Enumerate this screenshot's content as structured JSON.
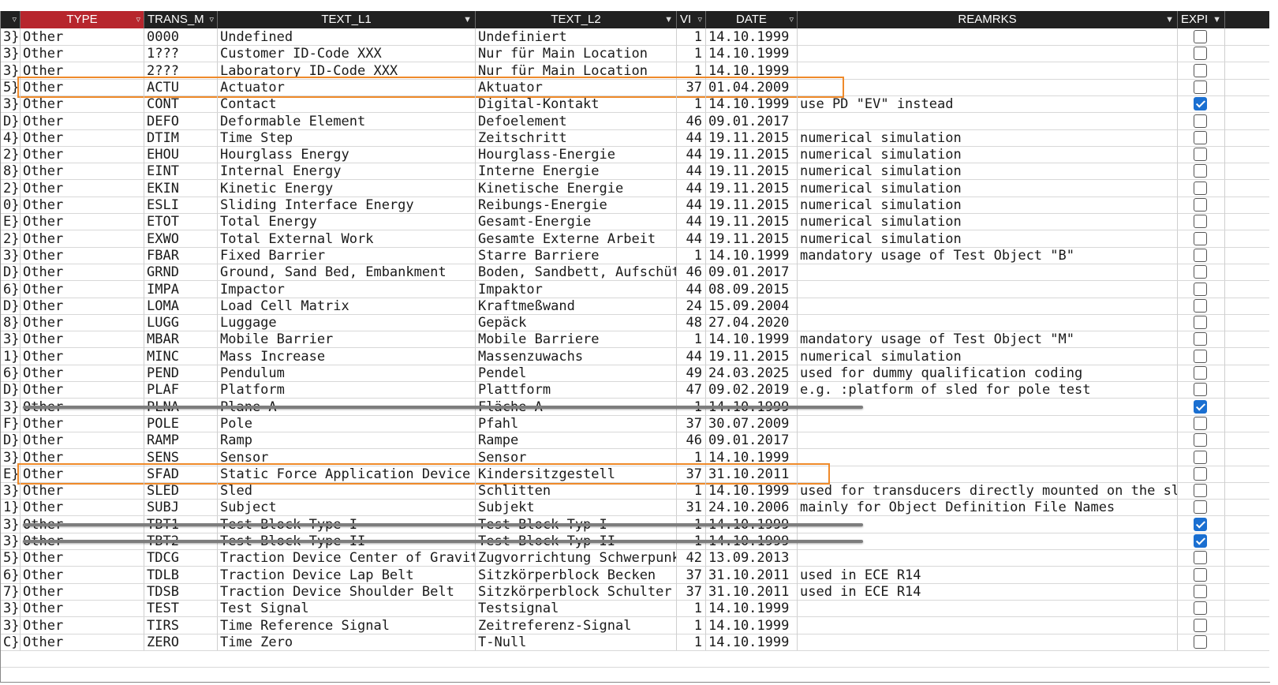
{
  "header": {
    "col_index": "",
    "col_type": "TYPE",
    "col_trans": "TRANS_M",
    "col_text1": "TEXT_L1",
    "col_text2": "TEXT_L2",
    "col_ver": "VI",
    "col_date": "DATE",
    "col_remarks": "REAMRKS",
    "col_expired": "EXPI",
    "filter_icon": "filter-icon",
    "sort_icon": "dropdown-arrow-icon"
  },
  "colors": {
    "header_bg": "#212121",
    "active_header": "#b7262d",
    "highlight_box": "#ef8a2a",
    "checked": "#1a6fd1"
  },
  "rows": [
    {
      "idx": "3}",
      "type": "Other",
      "code": "0000",
      "text1": "Undefined",
      "text2": "Undefiniert",
      "ver": "1",
      "date": "14.10.1999",
      "remarks": "",
      "expired": false,
      "struck": false
    },
    {
      "idx": "3}",
      "type": "Other",
      "code": "1???",
      "text1": "Customer ID-Code XXX",
      "text2": "Nur für Main Location",
      "ver": "1",
      "date": "14.10.1999",
      "remarks": "",
      "expired": false,
      "struck": false
    },
    {
      "idx": "3}",
      "type": "Other",
      "code": "2???",
      "text1": "Laboratory ID-Code XXX",
      "text2": "Nur für Main Location",
      "ver": "1",
      "date": "14.10.1999",
      "remarks": "",
      "expired": false,
      "struck": false
    },
    {
      "idx": "5}",
      "type": "Other",
      "code": "ACTU",
      "text1": "Actuator",
      "text2": "Aktuator",
      "ver": "37",
      "date": "01.04.2009",
      "remarks": "",
      "expired": false,
      "struck": false
    },
    {
      "idx": "3}",
      "type": "Other",
      "code": "CONT",
      "text1": "Contact",
      "text2": "Digital-Kontakt",
      "ver": "1",
      "date": "14.10.1999",
      "remarks": "use PD \"EV\" instead",
      "expired": true,
      "struck": false
    },
    {
      "idx": "D}",
      "type": "Other",
      "code": "DEFO",
      "text1": "Deformable Element",
      "text2": "Defoelement",
      "ver": "46",
      "date": "09.01.2017",
      "remarks": "",
      "expired": false,
      "struck": false
    },
    {
      "idx": "4}",
      "type": "Other",
      "code": "DTIM",
      "text1": "Time Step",
      "text2": "Zeitschritt",
      "ver": "44",
      "date": "19.11.2015",
      "remarks": "numerical simulation",
      "expired": false,
      "struck": false
    },
    {
      "idx": "2}",
      "type": "Other",
      "code": "EHOU",
      "text1": "Hourglass Energy",
      "text2": "Hourglass-Energie",
      "ver": "44",
      "date": "19.11.2015",
      "remarks": "numerical simulation",
      "expired": false,
      "struck": false
    },
    {
      "idx": "8}",
      "type": "Other",
      "code": "EINT",
      "text1": "Internal Energy",
      "text2": "Interne Energie",
      "ver": "44",
      "date": "19.11.2015",
      "remarks": "numerical simulation",
      "expired": false,
      "struck": false
    },
    {
      "idx": "2}",
      "type": "Other",
      "code": "EKIN",
      "text1": "Kinetic Energy",
      "text2": "Kinetische Energie",
      "ver": "44",
      "date": "19.11.2015",
      "remarks": "numerical simulation",
      "expired": false,
      "struck": false
    },
    {
      "idx": "0}",
      "type": "Other",
      "code": "ESLI",
      "text1": "Sliding Interface Energy",
      "text2": "Reibungs-Energie",
      "ver": "44",
      "date": "19.11.2015",
      "remarks": "numerical simulation",
      "expired": false,
      "struck": false
    },
    {
      "idx": "E}",
      "type": "Other",
      "code": "ETOT",
      "text1": "Total Energy",
      "text2": "Gesamt-Energie",
      "ver": "44",
      "date": "19.11.2015",
      "remarks": "numerical simulation",
      "expired": false,
      "struck": false
    },
    {
      "idx": "2}",
      "type": "Other",
      "code": "EXWO",
      "text1": "Total External Work",
      "text2": "Gesamte Externe Arbeit",
      "ver": "44",
      "date": "19.11.2015",
      "remarks": "numerical simulation",
      "expired": false,
      "struck": false
    },
    {
      "idx": "3}",
      "type": "Other",
      "code": "FBAR",
      "text1": "Fixed Barrier",
      "text2": "Starre Barriere",
      "ver": "1",
      "date": "14.10.1999",
      "remarks": "mandatory usage of Test Object \"B\"",
      "expired": false,
      "struck": false
    },
    {
      "idx": "D}",
      "type": "Other",
      "code": "GRND",
      "text1": "Ground, Sand Bed, Embankment",
      "text2": "Boden, Sandbett, Aufschütt",
      "ver": "46",
      "date": "09.01.2017",
      "remarks": "",
      "expired": false,
      "struck": false
    },
    {
      "idx": "6}",
      "type": "Other",
      "code": "IMPA",
      "text1": "Impactor",
      "text2": "Impaktor",
      "ver": "44",
      "date": "08.09.2015",
      "remarks": "",
      "expired": false,
      "struck": false
    },
    {
      "idx": "D}",
      "type": "Other",
      "code": "LOMA",
      "text1": "Load Cell Matrix",
      "text2": "Kraftmeßwand",
      "ver": "24",
      "date": "15.09.2004",
      "remarks": "",
      "expired": false,
      "struck": false
    },
    {
      "idx": "8}",
      "type": "Other",
      "code": "LUGG",
      "text1": "Luggage",
      "text2": "Gepäck",
      "ver": "48",
      "date": "27.04.2020",
      "remarks": "",
      "expired": false,
      "struck": false
    },
    {
      "idx": "3}",
      "type": "Other",
      "code": "MBAR",
      "text1": "Mobile Barrier",
      "text2": "Mobile Barriere",
      "ver": "1",
      "date": "14.10.1999",
      "remarks": "mandatory usage of Test Object \"M\"",
      "expired": false,
      "struck": false
    },
    {
      "idx": "1}",
      "type": "Other",
      "code": "MINC",
      "text1": "Mass Increase",
      "text2": "Massenzuwachs",
      "ver": "44",
      "date": "19.11.2015",
      "remarks": "numerical simulation",
      "expired": false,
      "struck": false
    },
    {
      "idx": "6}",
      "type": "Other",
      "code": "PEND",
      "text1": "Pendulum",
      "text2": "Pendel",
      "ver": "49",
      "date": "24.03.2025",
      "remarks": "used for dummy qualification coding",
      "expired": false,
      "struck": false
    },
    {
      "idx": "D}",
      "type": "Other",
      "code": "PLAF",
      "text1": "Platform",
      "text2": "Plattform",
      "ver": "47",
      "date": "09.02.2019",
      "remarks": "e.g. :platform of sled for pole test",
      "expired": false,
      "struck": false
    },
    {
      "idx": "3}",
      "type": "Other",
      "code": "PLNA",
      "text1": "Plane A",
      "text2": "Fläche A",
      "ver": "1",
      "date": "14.10.1999",
      "remarks": "",
      "expired": true,
      "struck": true
    },
    {
      "idx": "F}",
      "type": "Other",
      "code": "POLE",
      "text1": "Pole",
      "text2": "Pfahl",
      "ver": "37",
      "date": "30.07.2009",
      "remarks": "",
      "expired": false,
      "struck": false
    },
    {
      "idx": "D}",
      "type": "Other",
      "code": "RAMP",
      "text1": "Ramp",
      "text2": "Rampe",
      "ver": "46",
      "date": "09.01.2017",
      "remarks": "",
      "expired": false,
      "struck": false
    },
    {
      "idx": "3}",
      "type": "Other",
      "code": "SENS",
      "text1": "Sensor",
      "text2": "Sensor",
      "ver": "1",
      "date": "14.10.1999",
      "remarks": "",
      "expired": false,
      "struck": false
    },
    {
      "idx": "E}",
      "type": "Other",
      "code": "SFAD",
      "text1": "Static Force Application Device",
      "text2": "Kindersitzgestell",
      "ver": "37",
      "date": "31.10.2011",
      "remarks": "",
      "expired": false,
      "struck": false
    },
    {
      "idx": "3}",
      "type": "Other",
      "code": "SLED",
      "text1": "Sled",
      "text2": "Schlitten",
      "ver": "1",
      "date": "14.10.1999",
      "remarks": "used for transducers directly mounted on the sled",
      "expired": false,
      "struck": false
    },
    {
      "idx": "1}",
      "type": "Other",
      "code": "SUBJ",
      "text1": "Subject",
      "text2": "Subjekt",
      "ver": "31",
      "date": "24.10.2006",
      "remarks": "mainly for Object Definition File Names",
      "expired": false,
      "struck": false
    },
    {
      "idx": "3}",
      "type": "Other",
      "code": "TBT1",
      "text1": "Test Block Type I",
      "text2": "Test Block Typ I",
      "ver": "1",
      "date": "14.10.1999",
      "remarks": "",
      "expired": true,
      "struck": true
    },
    {
      "idx": "3}",
      "type": "Other",
      "code": "TBT2",
      "text1": "Test Block Type II",
      "text2": "Test Block Typ II",
      "ver": "1",
      "date": "14.10.1999",
      "remarks": "",
      "expired": true,
      "struck": true
    },
    {
      "idx": "5}",
      "type": "Other",
      "code": "TDCG",
      "text1": "Traction Device Center of Gravity",
      "text2": "Zugvorrichtung Schwerpunkt",
      "ver": "42",
      "date": "13.09.2013",
      "remarks": "",
      "expired": false,
      "struck": false
    },
    {
      "idx": "6}",
      "type": "Other",
      "code": "TDLB",
      "text1": "Traction Device Lap Belt",
      "text2": "Sitzkörperblock Becken",
      "ver": "37",
      "date": "31.10.2011",
      "remarks": "used in ECE R14",
      "expired": false,
      "struck": false
    },
    {
      "idx": "7}",
      "type": "Other",
      "code": "TDSB",
      "text1": "Traction Device Shoulder Belt",
      "text2": "Sitzkörperblock Schulter",
      "ver": "37",
      "date": "31.10.2011",
      "remarks": "used in ECE R14",
      "expired": false,
      "struck": false
    },
    {
      "idx": "3}",
      "type": "Other",
      "code": "TEST",
      "text1": "Test Signal",
      "text2": "Testsignal",
      "ver": "1",
      "date": "14.10.1999",
      "remarks": "",
      "expired": false,
      "struck": false
    },
    {
      "idx": "3}",
      "type": "Other",
      "code": "TIRS",
      "text1": "Time Reference Signal",
      "text2": "Zeitreferenz-Signal",
      "ver": "1",
      "date": "14.10.1999",
      "remarks": "",
      "expired": false,
      "struck": false
    },
    {
      "idx": "C}",
      "type": "Other",
      "code": "ZERO",
      "text1": "Time Zero",
      "text2": "T-Null",
      "ver": "1",
      "date": "14.10.1999",
      "remarks": "",
      "expired": false,
      "struck": false
    }
  ],
  "highlighted_codes": [
    "ACTU",
    "SFAD"
  ]
}
